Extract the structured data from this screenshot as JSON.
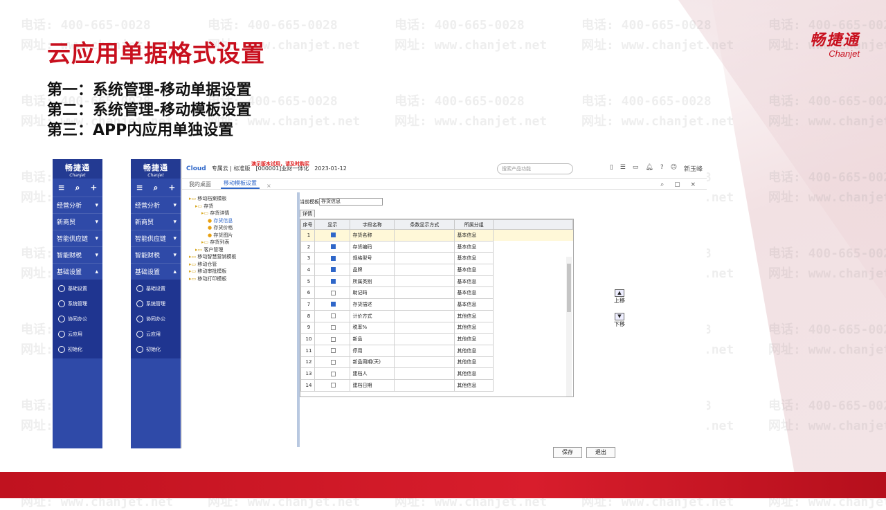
{
  "slide": {
    "title": "云应用单据格式设置",
    "logo_cn": "畅捷通",
    "logo_en": "Chanjet",
    "steps": [
      "第一：系统管理-移动单据设置",
      "第二：系统管理-移动模板设置",
      "第三：APP内应用单独设置"
    ],
    "watermark_phone": "电话: 400-665-0028",
    "watermark_site": "网址: www.chanjet.net"
  },
  "phone_nav": {
    "brand_cn": "畅捷通",
    "brand_en": "Chanjet",
    "tools": [
      "≡",
      "⌕",
      "+"
    ],
    "menu": [
      {
        "label": "经营分析",
        "arrow": "▾"
      },
      {
        "label": "新商贸",
        "arrow": "▾"
      },
      {
        "label": "智能供应链",
        "arrow": "▾"
      },
      {
        "label": "智能财税",
        "arrow": "▾"
      },
      {
        "label": "基础设置",
        "arrow": "▴"
      }
    ],
    "sub_menu": [
      "基础设置",
      "系统管理",
      "协同办公",
      "云应用",
      "初始化"
    ]
  },
  "app": {
    "brand": "Cloud",
    "edition": "专属云 | 标准版",
    "account": "[000001]业财一体化",
    "date": "2023-01-12",
    "notice": "演示版本试用，请及时购买",
    "search_placeholder": "搜索产品功能",
    "user": "新玉峰",
    "tabs": [
      {
        "label": "我的桌面"
      },
      {
        "label": "移动模板设置"
      }
    ],
    "tree": [
      {
        "label": "移动档案模板",
        "indent": 0
      },
      {
        "label": "存货",
        "indent": 1
      },
      {
        "label": "存货详情",
        "indent": 2
      },
      {
        "label": "存货信息",
        "indent": 3,
        "selected": true
      },
      {
        "label": "存货价格",
        "indent": 3
      },
      {
        "label": "存货图片",
        "indent": 3
      },
      {
        "label": "存货列表",
        "indent": 2
      },
      {
        "label": "客户管理",
        "indent": 1
      },
      {
        "label": "移动智慧营销模板",
        "indent": 0
      },
      {
        "label": "移动仓管",
        "indent": 0
      },
      {
        "label": "移动审批模板",
        "indent": 0
      },
      {
        "label": "移动打印模板",
        "indent": 0
      }
    ],
    "current_template_label": "当前模板",
    "current_template_value": "存货信息",
    "detail_tab": "详情",
    "columns": [
      "序号",
      "显示",
      "字段名称",
      "条数显示方式",
      "所属分组"
    ],
    "rows": [
      {
        "no": "1",
        "show": true,
        "name": "存货名称",
        "mode": "",
        "group": "基本信息"
      },
      {
        "no": "2",
        "show": true,
        "name": "存货编码",
        "mode": "",
        "group": "基本信息"
      },
      {
        "no": "3",
        "show": true,
        "name": "规格型号",
        "mode": "",
        "group": "基本信息"
      },
      {
        "no": "4",
        "show": true,
        "name": "品牌",
        "mode": "",
        "group": "基本信息"
      },
      {
        "no": "5",
        "show": true,
        "name": "所属类别",
        "mode": "",
        "group": "基本信息"
      },
      {
        "no": "6",
        "show": false,
        "name": "助记码",
        "mode": "",
        "group": "基本信息"
      },
      {
        "no": "7",
        "show": true,
        "name": "存货描述",
        "mode": "",
        "group": "基本信息"
      },
      {
        "no": "8",
        "show": false,
        "name": "计价方式",
        "mode": "",
        "group": "其他信息"
      },
      {
        "no": "9",
        "show": false,
        "name": "税率%",
        "mode": "",
        "group": "其他信息"
      },
      {
        "no": "10",
        "show": false,
        "name": "新品",
        "mode": "",
        "group": "其他信息"
      },
      {
        "no": "11",
        "show": false,
        "name": "停用",
        "mode": "",
        "group": "其他信息"
      },
      {
        "no": "12",
        "show": false,
        "name": "新品周期(天)",
        "mode": "",
        "group": "其他信息"
      },
      {
        "no": "13",
        "show": false,
        "name": "建档人",
        "mode": "",
        "group": "其他信息"
      },
      {
        "no": "14",
        "show": false,
        "name": "建档日期",
        "mode": "",
        "group": "其他信息"
      }
    ],
    "move_up": "上移",
    "move_down": "下移",
    "save": "保存",
    "exit": "退出"
  }
}
